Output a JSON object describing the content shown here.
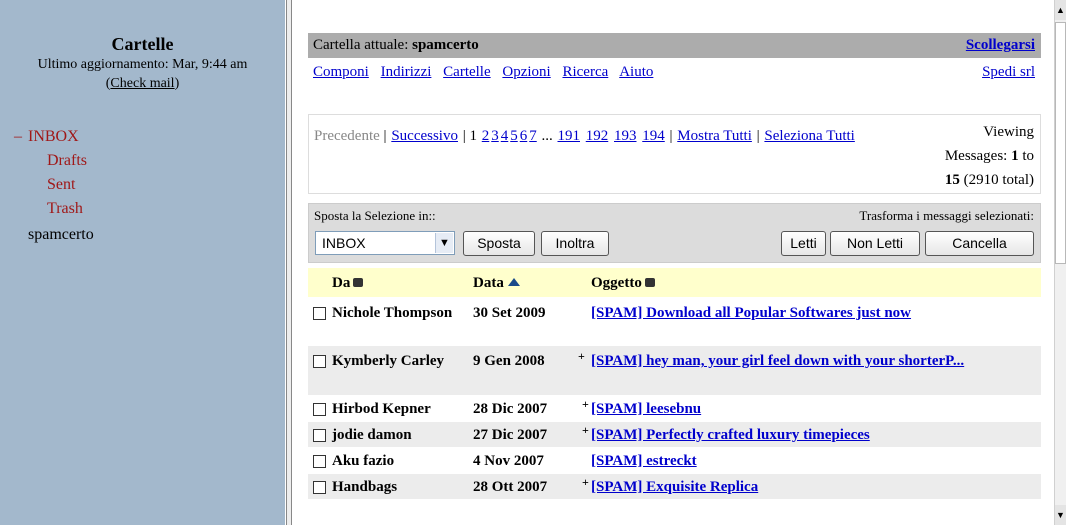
{
  "left": {
    "title": "Cartelle",
    "updated": "Ultimo aggiornamento: Mar, 9:44 am",
    "check_mail": "Check mail",
    "collapse": "–",
    "folders": [
      {
        "label": "INBOX"
      },
      {
        "label": "Drafts"
      },
      {
        "label": "Sent"
      },
      {
        "label": "Trash"
      },
      {
        "label": "spamcerto"
      }
    ]
  },
  "header": {
    "current_prefix": "Cartella attuale: ",
    "current_folder": "spamcerto",
    "logout": "Scollegarsi"
  },
  "nav": {
    "items": [
      "Componi",
      "Indirizzi",
      "Cartelle",
      "Opzioni",
      "Ricerca",
      "Aiuto"
    ],
    "right": "Spedi srl"
  },
  "pager": {
    "prev": "Precedente",
    "next": "Successivo",
    "current": "1",
    "pages": [
      "2",
      "3",
      "4",
      "5",
      "6",
      "7"
    ],
    "ellipsis": "...",
    "last_pages": [
      "191",
      "192",
      "193",
      "194"
    ],
    "show_all": "Mostra Tutti",
    "select_all": "Seleziona Tutti",
    "viewing_label": "Viewing",
    "messages_label": "Messages:",
    "from": "1",
    "to_label": "to",
    "to": "15",
    "total": "(2910 total)"
  },
  "controls": {
    "move_label": "Sposta la Selezione in::",
    "transform_label": "Trasforma i messaggi selezionati:",
    "folder_select": "INBOX",
    "move_button": "Sposta",
    "forward_button": "Inoltra",
    "read_button": "Letti",
    "unread_button": "Non Letti",
    "delete_button": "Cancella"
  },
  "table": {
    "col_from": "Da",
    "col_date": "Data",
    "col_subject": "Oggetto",
    "rows": [
      {
        "from": "Nichole Thompson",
        "date": "30 Set 2009",
        "plus": "",
        "subject": "[SPAM] Download all Popular Softwares just now"
      },
      {
        "from": "Kymberly Carley",
        "date": "9 Gen 2008",
        "plus": "+",
        "subject": "[SPAM] hey man, your girl feel down with your shorterP..."
      },
      {
        "from": "Hirbod Kepner",
        "date": "28 Dic 2007",
        "plus": "+",
        "subject": "[SPAM] leesebnu"
      },
      {
        "from": "jodie damon",
        "date": "27 Dic 2007",
        "plus": "+",
        "subject": "[SPAM] Perfectly crafted luxury timepieces"
      },
      {
        "from": "Aku fazio",
        "date": "4 Nov 2007",
        "plus": "",
        "subject": "[SPAM] estreckt"
      },
      {
        "from": "Handbags",
        "date": "28 Ott 2007",
        "plus": "+",
        "subject": "[SPAM] Exquisite Replica"
      }
    ]
  }
}
